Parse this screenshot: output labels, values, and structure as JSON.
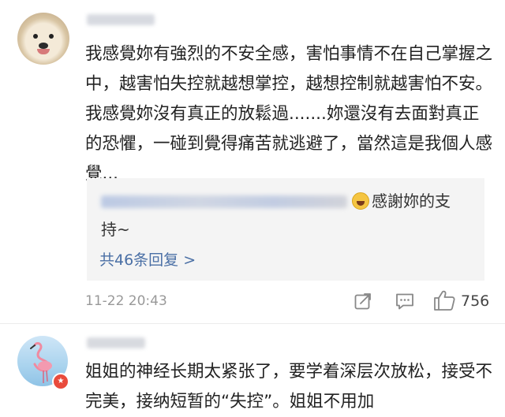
{
  "comments": [
    {
      "text": "我感覺妳有強烈的不安全感，害怕事情不在自己掌握之中，越害怕失控就越想掌控，越想控制就越害怕不安。我感覺妳沒有真正的放鬆過.......妳還沒有去面對真正的恐懼，一碰到覺得痛苦就逃避了，當然這是我個人感覺...",
      "reply_preview_line1": "感謝妳的支",
      "reply_preview_line2": "持~",
      "reply_more": "共46条回复 >",
      "time": "11-22 20:43",
      "likes": "756"
    },
    {
      "text": "姐姐的神经长期太紧张了，要学着深层次放松，接受不完美，接纳短暂的“失控”。姐姐不用加"
    }
  ],
  "icons": {
    "share": "share-icon",
    "comment": "comment-icon",
    "like": "thumbs-up-icon"
  },
  "colors": {
    "link": "#4a6fa5",
    "meta": "#999999",
    "reply_bg": "#f4f4f4"
  }
}
